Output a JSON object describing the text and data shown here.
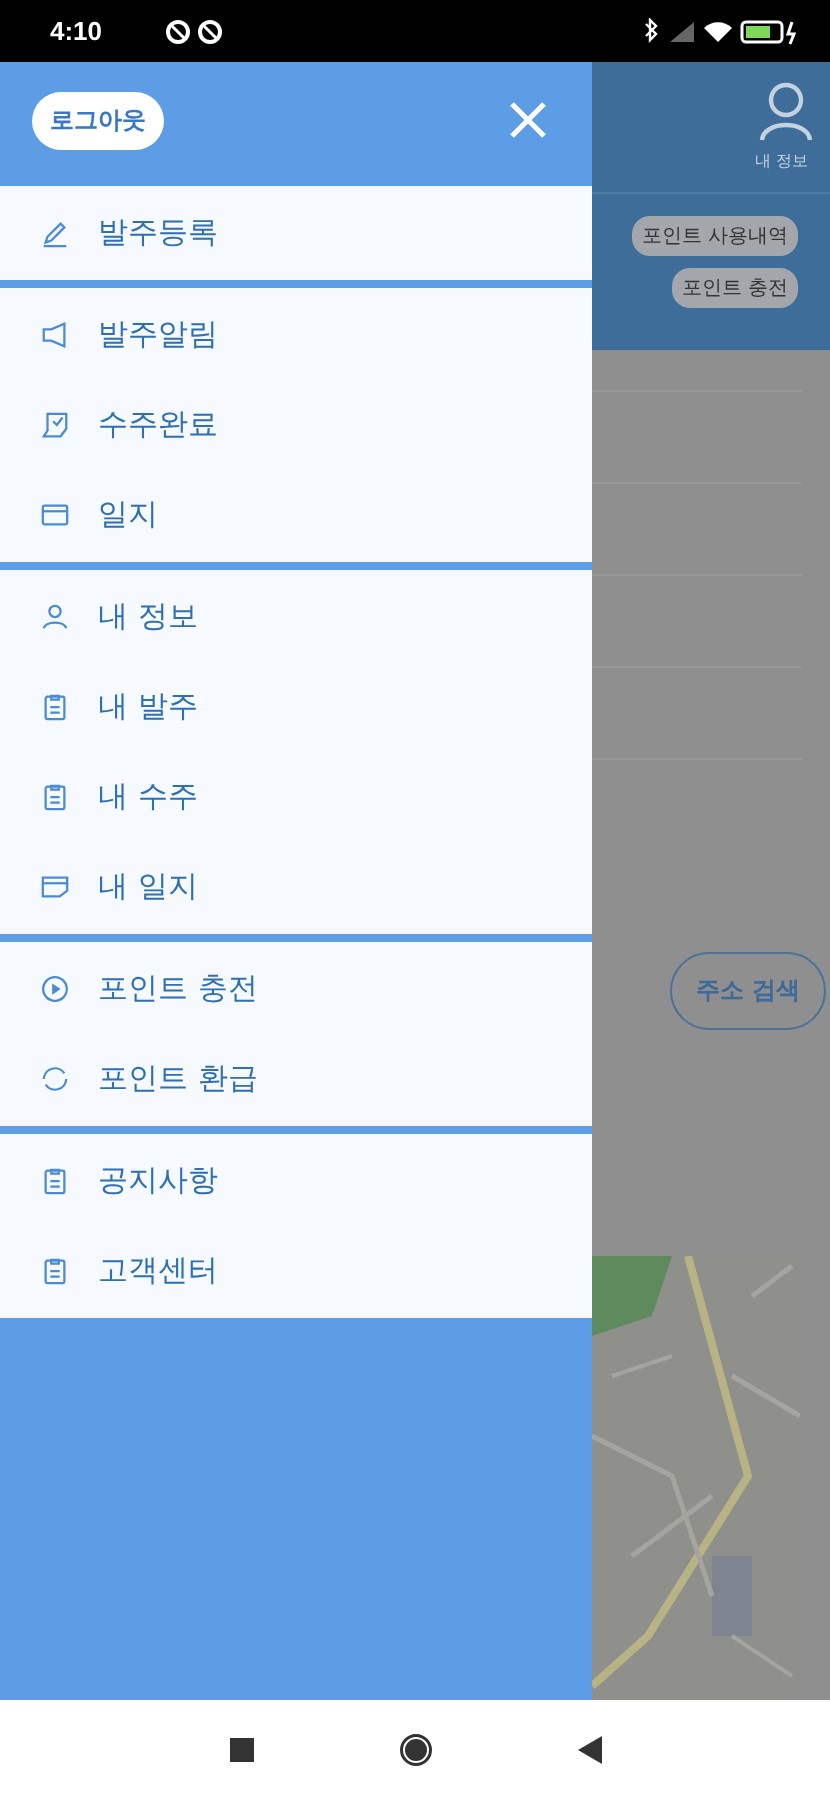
{
  "status_bar": {
    "time": "4:10"
  },
  "drawer": {
    "logout_button": "로그아웃",
    "groups": [
      {
        "items": [
          {
            "label": "발주등록"
          }
        ]
      },
      {
        "items": [
          {
            "label": "발주알림"
          },
          {
            "label": "수주완료"
          },
          {
            "label": "일지"
          }
        ]
      },
      {
        "items": [
          {
            "label": "내 정보"
          },
          {
            "label": "내 발주"
          },
          {
            "label": "내 수주"
          },
          {
            "label": "내 일지"
          }
        ]
      },
      {
        "items": [
          {
            "label": "포인트 충전"
          },
          {
            "label": "포인트 환급"
          }
        ]
      },
      {
        "items": [
          {
            "label": "공지사항"
          },
          {
            "label": "고객센터"
          }
        ]
      }
    ]
  },
  "background_page": {
    "profile_label": "내 정보",
    "chips": [
      "포인트 사용내역",
      "포인트 충전"
    ],
    "address_search_button": "주소 검색",
    "map": {
      "kind": "picture"
    }
  }
}
